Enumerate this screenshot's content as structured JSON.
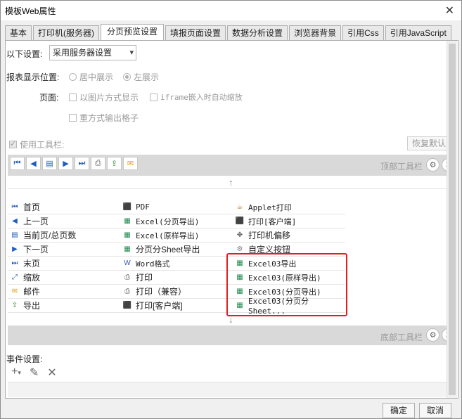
{
  "window": {
    "title": "模板Web属性",
    "close": "✕"
  },
  "tabs": [
    {
      "label": "基本"
    },
    {
      "label": "打印机(服务器)"
    },
    {
      "label": "分页预览设置"
    },
    {
      "label": "填报页面设置"
    },
    {
      "label": "数据分析设置"
    },
    {
      "label": "浏览器背景"
    },
    {
      "label": "引用Css"
    },
    {
      "label": "引用JavaScript"
    }
  ],
  "settings": {
    "mode_label": "以下设置:",
    "mode_value": "采用服务器设置",
    "position_label": "报表显示位置:",
    "center_label": "居中展示",
    "left_label": "左展示",
    "page_label": "页面:",
    "image_mode_label": "以图片方式显示",
    "iframe_label": "iframe嵌入时自动缩放",
    "repeat_label": "重方式输出格子",
    "use_toolbar_label": "使用工具栏:",
    "restore_label": "恢复默认"
  },
  "toolbar": {
    "top_label": "顶部工具栏",
    "bottom_label": "底部工具栏",
    "up_arrow": "↑",
    "down_arrow": "↓"
  },
  "items": {
    "col1": [
      {
        "label": "首页",
        "icon": "first-page-icon"
      },
      {
        "label": "上一页",
        "icon": "prev-page-icon"
      },
      {
        "label": "当前页/总页数",
        "icon": "page-count-icon"
      },
      {
        "label": "下一页",
        "icon": "next-page-icon"
      },
      {
        "label": "末页",
        "icon": "last-page-icon"
      },
      {
        "label": "缩放",
        "icon": "zoom-icon"
      },
      {
        "label": "邮件",
        "icon": "mail-icon"
      },
      {
        "label": "导出",
        "icon": "export-icon"
      }
    ],
    "col2": [
      {
        "label": "PDF",
        "icon": "pdf-icon"
      },
      {
        "label": "Excel(分页导出)",
        "icon": "excel-icon"
      },
      {
        "label": "Excel(原样导出)",
        "icon": "excel-icon"
      },
      {
        "label": "分页分Sheet导出",
        "icon": "excel-icon"
      },
      {
        "label": "Word格式",
        "icon": "word-icon"
      },
      {
        "label": "打印",
        "icon": "print-icon"
      },
      {
        "label": "打印（兼容）",
        "icon": "print-icon"
      },
      {
        "label": "打印[客户端]",
        "icon": "print-client-icon"
      }
    ],
    "col3": [
      {
        "label": "Applet打印",
        "icon": "applet-icon"
      },
      {
        "label": "打印[客户端]",
        "icon": "pdf-print-icon"
      },
      {
        "label": "打印机偏移",
        "icon": "move-icon"
      },
      {
        "label": "自定义按钮",
        "icon": "custom-button-icon"
      },
      {
        "label": "Excel03导出",
        "icon": "excel-icon"
      },
      {
        "label": "Excel03(原样导出)",
        "icon": "excel-icon"
      },
      {
        "label": "Excel03(分页导出)",
        "icon": "excel-icon"
      },
      {
        "label": "Excel03(分页分Sheet...",
        "icon": "excel-icon"
      }
    ]
  },
  "events": {
    "label": "事件设置:"
  },
  "footer": {
    "ok": "确定",
    "cancel": "取消"
  }
}
